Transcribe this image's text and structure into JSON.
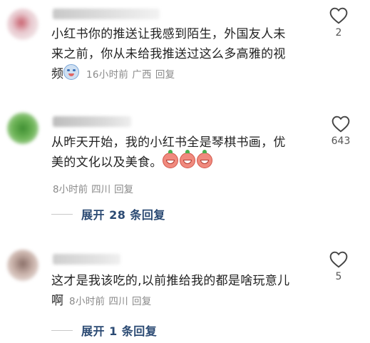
{
  "comments": [
    {
      "text_lines": [
        "小红书你的推送让我感到陌生，外国友人未",
        "来之前，你从未给我推送过这么多高雅的视"
      ],
      "last_text": "频",
      "emoji": "crying-emoji",
      "time": "16小时前",
      "location": "广西",
      "reply_label": "回复",
      "likes": "2",
      "avatar_color": "#e8c9cf",
      "username_color": "#d6d6d6"
    },
    {
      "text_lines": [
        "从昨天开始，我的小红书全是琴棋书画，优"
      ],
      "last_text": "美的文化以及美食。",
      "emoji": "laughing-emoji",
      "emoji_count": 3,
      "time": "8小时前",
      "location": "四川",
      "reply_label": "回复",
      "likes": "643",
      "expand_label": "展开 28 条回复",
      "avatar_color": "#5fa84a",
      "username_color": "#cfcfcf"
    },
    {
      "text_lines": [
        "这才是我该吃的,以前推给我的都是啥玩意儿"
      ],
      "last_text": "啊",
      "time": "8小时前",
      "location": "四川",
      "reply_label": "回复",
      "likes": "5",
      "expand_label": "展开 1 条回复",
      "avatar_color": "#c9b2aa",
      "username_color": "#d9d9d9"
    }
  ]
}
